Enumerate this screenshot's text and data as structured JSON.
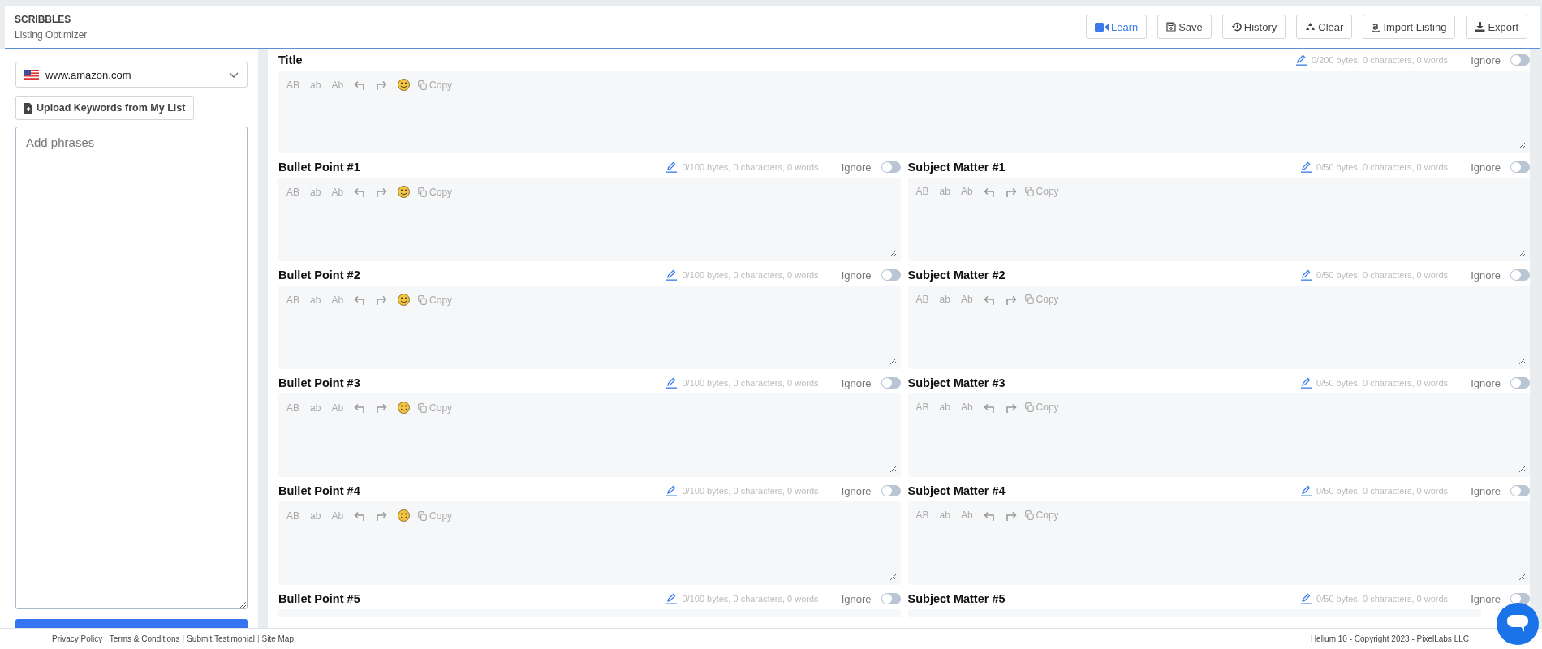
{
  "header": {
    "title": "SCRIBBLES",
    "subtitle": "Listing Optimizer",
    "buttons": [
      {
        "kind": "learn",
        "label": "Learn"
      },
      {
        "kind": "save",
        "label": "Save"
      },
      {
        "kind": "history",
        "label": "History"
      },
      {
        "kind": "clear",
        "label": "Clear"
      },
      {
        "kind": "import",
        "label": "Import Listing"
      },
      {
        "kind": "export",
        "label": "Export"
      }
    ]
  },
  "sidebar": {
    "marketplace": "www.amazon.com",
    "upload_button": "Upload Keywords from My List",
    "phrases": {
      "placeholder": "Add phrases"
    }
  },
  "title_field": {
    "label": "Title",
    "stats": "0/200 bytes, 0 characters, 0 words",
    "ignore_label": "Ignore",
    "ignore_on": false,
    "toolbar": {
      "case_buttons": [
        "AB",
        "ab",
        "Ab"
      ],
      "emoji": true,
      "copy": "Copy"
    }
  },
  "field_rows": [
    {
      "bullet": {
        "label": "Bullet Point #1",
        "stats": "0/100 bytes, 0 characters, 0 words",
        "ignore_label": "Ignore",
        "ignore_on": false,
        "toolbar": {
          "case_buttons": [
            "AB",
            "ab",
            "Ab"
          ],
          "emoji": true,
          "copy": "Copy"
        }
      },
      "subject": {
        "label": "Subject Matter #1",
        "stats": "0/50 bytes, 0 characters, 0 words",
        "ignore_label": "Ignore",
        "ignore_on": false,
        "toolbar": {
          "case_buttons": [
            "AB",
            "ab",
            "Ab"
          ],
          "emoji": false,
          "copy": "Copy"
        }
      }
    },
    {
      "bullet": {
        "label": "Bullet Point #2",
        "stats": "0/100 bytes, 0 characters, 0 words",
        "ignore_label": "Ignore",
        "ignore_on": false,
        "toolbar": {
          "case_buttons": [
            "AB",
            "ab",
            "Ab"
          ],
          "emoji": true,
          "copy": "Copy"
        }
      },
      "subject": {
        "label": "Subject Matter #2",
        "stats": "0/50 bytes, 0 characters, 0 words",
        "ignore_label": "Ignore",
        "ignore_on": false,
        "toolbar": {
          "case_buttons": [
            "AB",
            "ab",
            "Ab"
          ],
          "emoji": false,
          "copy": "Copy"
        }
      }
    },
    {
      "bullet": {
        "label": "Bullet Point #3",
        "stats": "0/100 bytes, 0 characters, 0 words",
        "ignore_label": "Ignore",
        "ignore_on": false,
        "toolbar": {
          "case_buttons": [
            "AB",
            "ab",
            "Ab"
          ],
          "emoji": true,
          "copy": "Copy"
        }
      },
      "subject": {
        "label": "Subject Matter #3",
        "stats": "0/50 bytes, 0 characters, 0 words",
        "ignore_label": "Ignore",
        "ignore_on": false,
        "toolbar": {
          "case_buttons": [
            "AB",
            "ab",
            "Ab"
          ],
          "emoji": false,
          "copy": "Copy"
        }
      }
    },
    {
      "bullet": {
        "label": "Bullet Point #4",
        "stats": "0/100 bytes, 0 characters, 0 words",
        "ignore_label": "Ignore",
        "ignore_on": false,
        "toolbar": {
          "case_buttons": [
            "AB",
            "ab",
            "Ab"
          ],
          "emoji": true,
          "copy": "Copy"
        }
      },
      "subject": {
        "label": "Subject Matter #4",
        "stats": "0/50 bytes, 0 characters, 0 words",
        "ignore_label": "Ignore",
        "ignore_on": false,
        "toolbar": {
          "case_buttons": [
            "AB",
            "ab",
            "Ab"
          ],
          "emoji": false,
          "copy": "Copy"
        }
      }
    },
    {
      "bullet": {
        "label": "Bullet Point #5",
        "stats": "0/100 bytes, 0 characters, 0 words",
        "ignore_label": "Ignore",
        "ignore_on": false
      },
      "subject": {
        "label": "Subject Matter #5",
        "stats": "0/50 bytes, 0 characters, 0 words",
        "ignore_label": "Ignore",
        "ignore_on": false
      }
    }
  ],
  "footer": {
    "items": [
      {
        "kind": "link",
        "text": "Privacy Policy"
      },
      {
        "kind": "sep",
        "text": "|"
      },
      {
        "kind": "link",
        "text": "Terms & Conditions"
      },
      {
        "kind": "sep",
        "text": "|"
      },
      {
        "kind": "link",
        "text": "Submit Testimonial"
      },
      {
        "kind": "sep",
        "text": "|"
      },
      {
        "kind": "link",
        "text": "Site Map"
      }
    ],
    "copyright": "Helium 10 - Copyright 2023 - PixelLabs LLC"
  }
}
